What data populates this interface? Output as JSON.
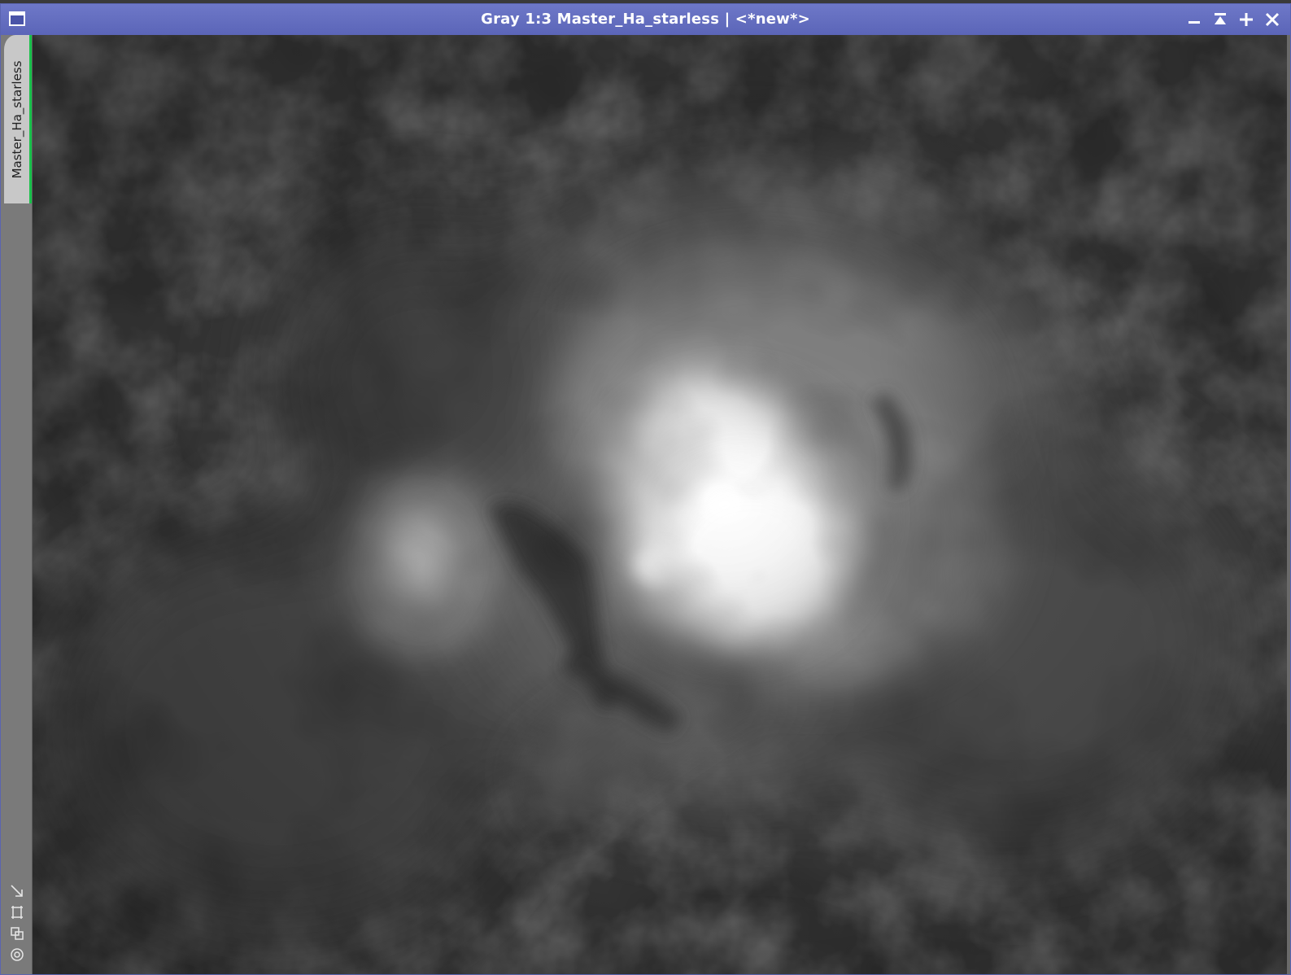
{
  "window": {
    "title": "Gray 1:3 Master_Ha_starless | <*new*>",
    "accent_color": "#5b65b8",
    "tab_accent_color": "#18c24a"
  },
  "title_controls": [
    {
      "name": "minimize",
      "icon": "minus-icon"
    },
    {
      "name": "shade",
      "icon": "shade-icon"
    },
    {
      "name": "maximize",
      "icon": "plus-icon"
    },
    {
      "name": "close",
      "icon": "close-icon"
    }
  ],
  "sidebar": {
    "tab_label": "Master_Ha_starless",
    "tools": [
      {
        "name": "fit-view",
        "icon": "arrow-down-right-icon"
      },
      {
        "name": "zoom-to-fit",
        "icon": "frame-icon"
      },
      {
        "name": "clone-view",
        "icon": "copy-icon"
      },
      {
        "name": "target",
        "icon": "target-icon"
      }
    ]
  },
  "image": {
    "description_icon": "nebula-image"
  }
}
